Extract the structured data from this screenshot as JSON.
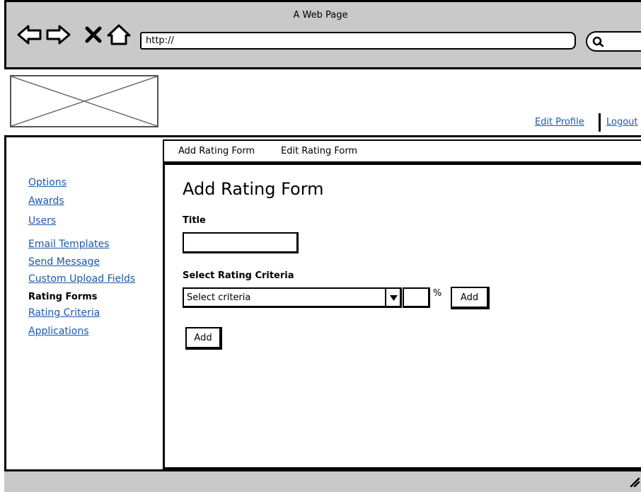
{
  "window": {
    "title": "A Web Page"
  },
  "toolbar": {
    "url": "http://"
  },
  "header": {
    "edit_profile": "Edit Profile",
    "logout": "Logout"
  },
  "sidebar": {
    "items": [
      {
        "label": "Options"
      },
      {
        "label": "Awards"
      },
      {
        "label": "Users"
      },
      {
        "label": "Email Templates"
      },
      {
        "label": "Send Message"
      },
      {
        "label": "Custom Upload Fields"
      },
      {
        "label": "Rating Forms",
        "current": true
      },
      {
        "label": "Rating Criteria"
      },
      {
        "label": "Applications"
      }
    ]
  },
  "tabs": [
    {
      "label": "Add Rating Form"
    },
    {
      "label": "Edit Rating Form"
    }
  ],
  "form": {
    "heading": "Add Rating Form",
    "title_label": "Title",
    "title_value": "",
    "criteria_label": "Select Rating Criteria",
    "criteria_selected": "Select criteria",
    "percent_value": "",
    "percent_symbol": "%",
    "add_criteria_label": "Add",
    "add_form_label": "Add"
  },
  "icons": {
    "back": "arrow-left-icon",
    "forward": "arrow-right-icon",
    "stop": "close-icon",
    "home": "home-icon",
    "search": "search-icon",
    "dropdown": "chevron-down-icon",
    "resize": "resize-grip-icon",
    "logo": "image-placeholder"
  }
}
